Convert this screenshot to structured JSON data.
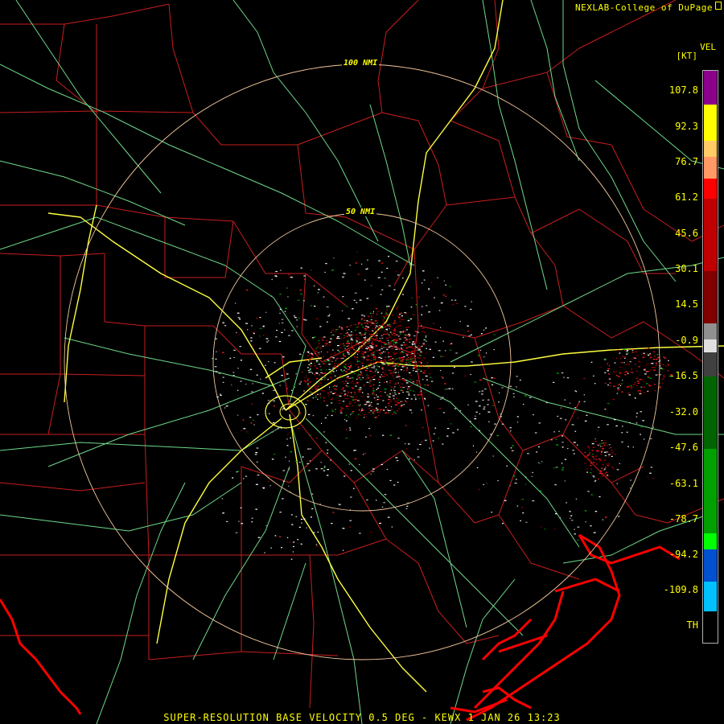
{
  "header": {
    "credit": "NEXLAB-College of DuPage"
  },
  "legend": {
    "product": "VEL",
    "unit": "[KT]",
    "ticks": [
      "107.8",
      "92.3",
      "76.7",
      "61.2",
      "45.6",
      "30.1",
      "14.5",
      "-0.9",
      "-16.5",
      "-32.0",
      "-47.6",
      "-63.1",
      "-78.7",
      "-94.2",
      "-109.8",
      "TH"
    ],
    "colors": {
      "purple": "#8b008b",
      "yellow": "#ffff00",
      "orange": "#ff9966",
      "red": "#ff0000",
      "darkred": "#800000",
      "gray": "#c0c0c0",
      "darkgreen": "#006400",
      "green": "#00ff00",
      "blue": "#0050d0",
      "cyan": "#00c0ff"
    }
  },
  "range_rings": {
    "inner": "50 NMI",
    "outer": "100 NMI"
  },
  "footer": {
    "title": "SUPER-RESOLUTION BASE VELOCITY 0.5 DEG - KEWX 1 JAN 26 13:23"
  },
  "map_colors": {
    "county": "#c81e1e",
    "highway": "#6fd98a",
    "interstate": "#ffff40",
    "coast": "#ff0000",
    "ring": "#f2c79b"
  }
}
